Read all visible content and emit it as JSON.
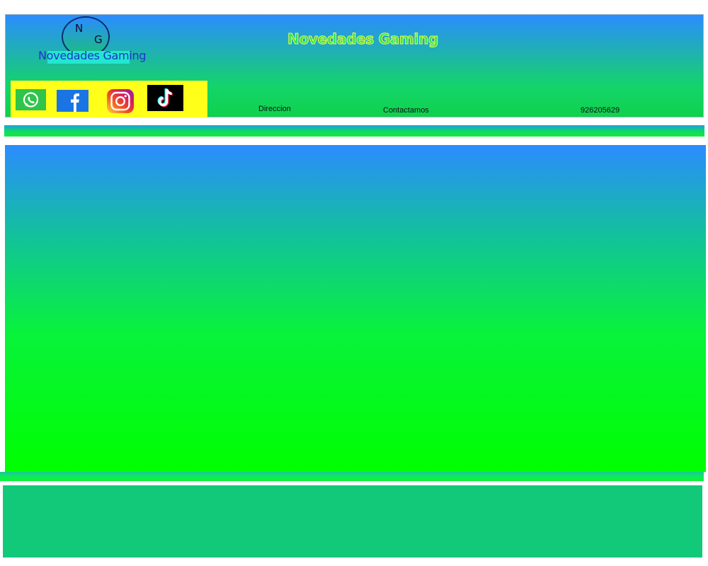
{
  "header": {
    "logo": {
      "letter_1": "N",
      "letter_2": "G",
      "text": "Novedades Gaming"
    },
    "title": "Novedades Gaming",
    "social": [
      {
        "name": "whatsapp-icon"
      },
      {
        "name": "facebook-icon"
      },
      {
        "name": "instagram-icon"
      },
      {
        "name": "tiktok-icon"
      }
    ],
    "nav": {
      "direccion": "Direccion",
      "contactamos": "Contactamos",
      "phone": "926205629"
    }
  },
  "colors": {
    "gradient_top": "#2b8cff",
    "gradient_bottom": "#00ff00",
    "social_bar": "#ffff1a",
    "footer": "#12c97a"
  }
}
